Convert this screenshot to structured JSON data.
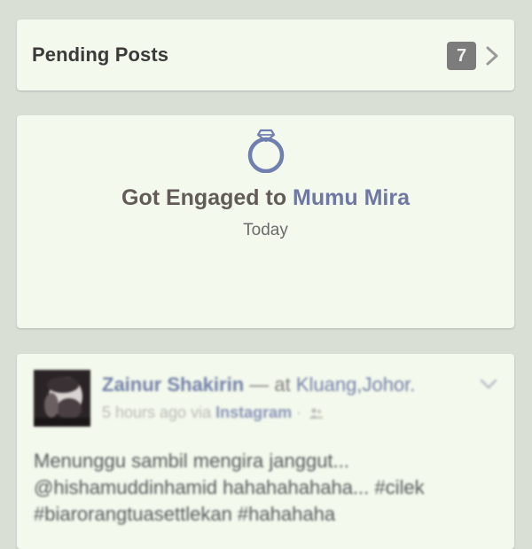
{
  "pending": {
    "title": "Pending Posts",
    "count": "7"
  },
  "life_event": {
    "icon": "ring-icon",
    "prefix": "Got Engaged to ",
    "person": "Mumu Mira",
    "date": "Today"
  },
  "post": {
    "author": "Zainur Shakirin",
    "at_text": " — at ",
    "place": "Kluang,Johor.",
    "time": "5 hours ago via ",
    "app": "Instagram",
    "separator": " · ",
    "text_line1": "Menunggu sambil mengira janggut...",
    "text_line2": "@hishamuddinhamid hahahahahaha... #cilek",
    "text_line3": "#biarorangtuasettlekan #hahahaha"
  },
  "colors": {
    "background": "#dadfd6",
    "card": "#f3f9ec",
    "link": "#6f78a3",
    "badge": "#7d7c7d"
  }
}
